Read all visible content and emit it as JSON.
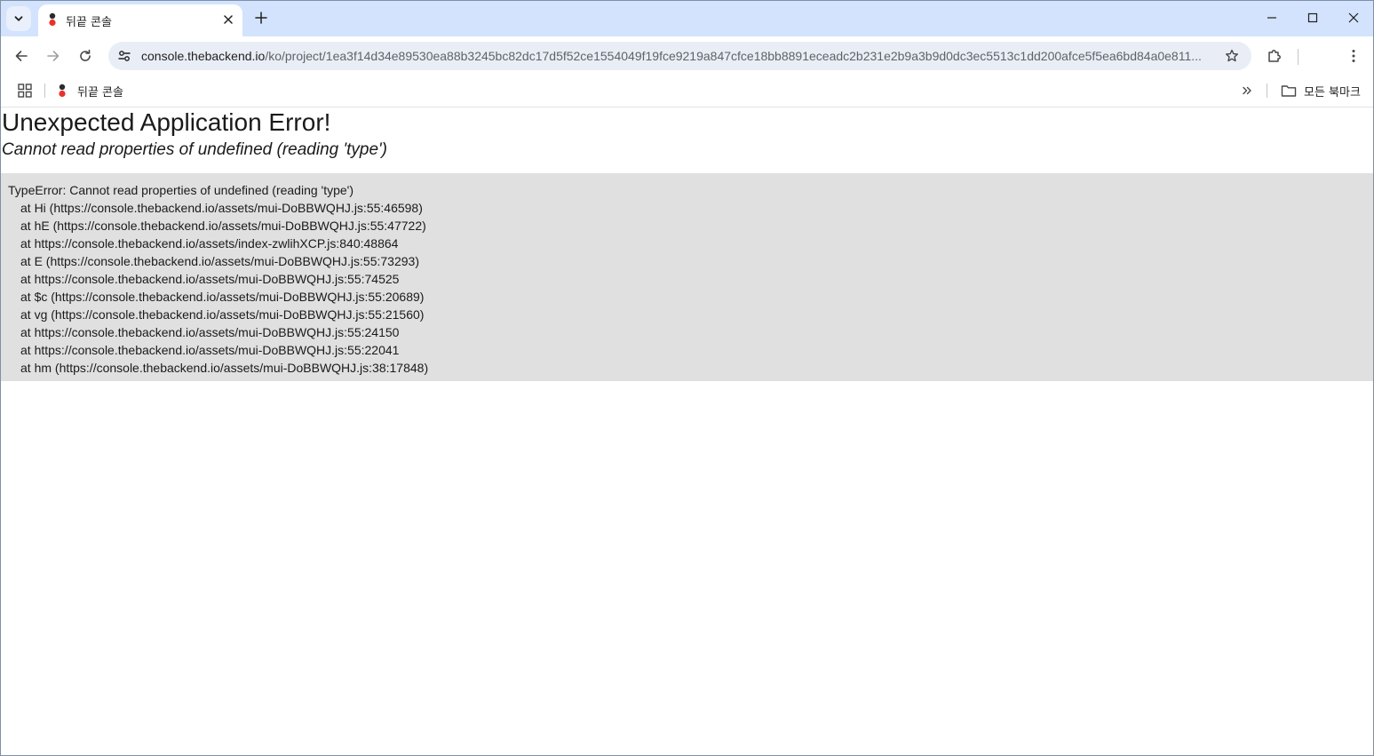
{
  "browser": {
    "tab": {
      "title": "뒤끝 콘솔"
    },
    "address_bar": {
      "host": "console.thebackend.io",
      "path": "/ko/project/1ea3f14d34e89530ea88b3245bc82dc17d5f52ce1554049f19fce9219a847cfce18bb8891eceadc2b231e2b9a3b9d0dc3ec5513c1dd200afce5f5ea6bd84a0e811..."
    },
    "bookmarks": {
      "items": [
        {
          "label": "뒤끝 콘솔"
        }
      ],
      "all_bookmarks_label": "모든 북마크"
    }
  },
  "page": {
    "title": "Unexpected Application Error!",
    "subtitle": "Cannot read properties of undefined (reading 'type')",
    "stack": {
      "error_line": "TypeError: Cannot read properties of undefined (reading 'type')",
      "frames": [
        "at Hi (https://console.thebackend.io/assets/mui-DoBBWQHJ.js:55:46598)",
        "at hE (https://console.thebackend.io/assets/mui-DoBBWQHJ.js:55:47722)",
        "at https://console.thebackend.io/assets/index-zwlihXCP.js:840:48864",
        "at E (https://console.thebackend.io/assets/mui-DoBBWQHJ.js:55:73293)",
        "at https://console.thebackend.io/assets/mui-DoBBWQHJ.js:55:74525",
        "at $c (https://console.thebackend.io/assets/mui-DoBBWQHJ.js:55:20689)",
        "at vg (https://console.thebackend.io/assets/mui-DoBBWQHJ.js:55:21560)",
        "at https://console.thebackend.io/assets/mui-DoBBWQHJ.js:55:24150",
        "at https://console.thebackend.io/assets/mui-DoBBWQHJ.js:55:22041",
        "at hm (https://console.thebackend.io/assets/mui-DoBBWQHJ.js:38:17848)"
      ]
    }
  },
  "icons": {
    "tab_search": "chevron-down-icon",
    "tab_close": "close-icon",
    "new_tab": "plus-icon",
    "minimize": "minimize-icon",
    "maximize": "maximize-icon",
    "close_window": "close-icon",
    "back": "arrow-left-icon",
    "forward": "arrow-right-icon",
    "reload": "reload-icon",
    "site_info": "tune-icon",
    "bookmark_star": "star-icon",
    "extensions": "puzzle-icon",
    "menu": "kebab-menu-icon",
    "apps": "grid-icon",
    "more_bookmarks": "double-chevron-icon",
    "folder": "folder-icon"
  },
  "colors": {
    "tabstrip_bg": "#d3e3fd",
    "omnibox_bg": "#e9eef6",
    "stack_bg": "#e0e0e0",
    "favicon_dark": "#2b2b2b",
    "favicon_red": "#e8322b"
  }
}
